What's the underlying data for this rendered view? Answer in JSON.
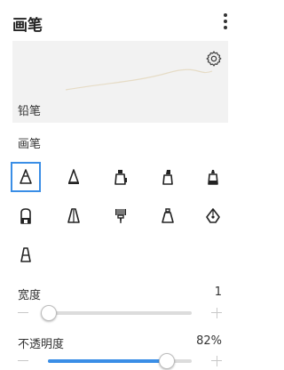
{
  "header": {
    "title": "画笔"
  },
  "preview": {
    "brush_name": "铅笔"
  },
  "brushes": {
    "section_label": "画笔",
    "items": [
      {
        "icon": "pencil-icon",
        "selected": true
      },
      {
        "icon": "pen-icon",
        "selected": false
      },
      {
        "icon": "marker-icon",
        "selected": false
      },
      {
        "icon": "highlighter-icon",
        "selected": false
      },
      {
        "icon": "felt-tip-icon",
        "selected": false
      },
      {
        "icon": "stamp-icon",
        "selected": false
      },
      {
        "icon": "calligraphy-pen-icon",
        "selected": false
      },
      {
        "icon": "paint-brush-icon",
        "selected": false
      },
      {
        "icon": "chalk-icon",
        "selected": false
      },
      {
        "icon": "fountain-pen-icon",
        "selected": false
      },
      {
        "icon": "crayon-icon",
        "selected": false
      }
    ]
  },
  "width": {
    "label": "宽度",
    "value": "1",
    "fraction": 0.0
  },
  "opacity": {
    "label": "不透明度",
    "value": "82%",
    "fraction": 0.82
  },
  "colors": {
    "accent": "#3a8ee6"
  }
}
